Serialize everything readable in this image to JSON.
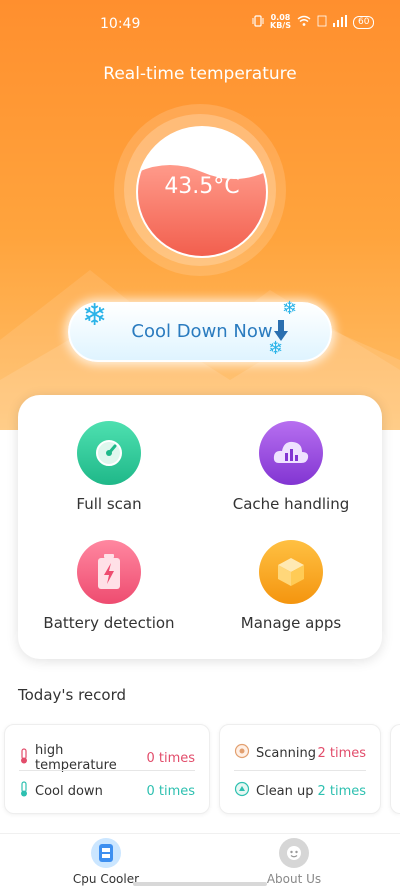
{
  "status_bar": {
    "time": "10:49",
    "net_speed_value": "0.08",
    "net_speed_unit": "KB/S",
    "battery": "60"
  },
  "header": {
    "title": "Real-time temperature",
    "temperature": "43.5°C"
  },
  "cool_button": {
    "label": "Cool Down Now"
  },
  "features": [
    {
      "label": "Full scan",
      "icon": "speedometer-icon",
      "color": "#2ec99a"
    },
    {
      "label": "Cache handling",
      "icon": "cloud-chart-icon",
      "color": "#9b4de0"
    },
    {
      "label": "Battery detection",
      "icon": "battery-icon",
      "color": "#f0577a"
    },
    {
      "label": "Manage apps",
      "icon": "box-icon",
      "color": "#f7a520"
    }
  ],
  "record": {
    "title": "Today's record",
    "card1": [
      {
        "label": "high temperature",
        "value": "0 times",
        "color": "#e24d6b"
      },
      {
        "label": "Cool down",
        "value": "0 times",
        "color": "#2ec0b0"
      }
    ],
    "card2": [
      {
        "label": "Scanning",
        "value": "2 times",
        "color": "#e24d6b"
      },
      {
        "label": "Clean up",
        "value": "2 times",
        "color": "#2ec0b0"
      }
    ]
  },
  "nav": [
    {
      "label": "Cpu Cooler",
      "active": true
    },
    {
      "label": "About Us",
      "active": false
    }
  ],
  "colors": {
    "accent": "#ff8f2e",
    "button_text": "#2a7bbf"
  }
}
